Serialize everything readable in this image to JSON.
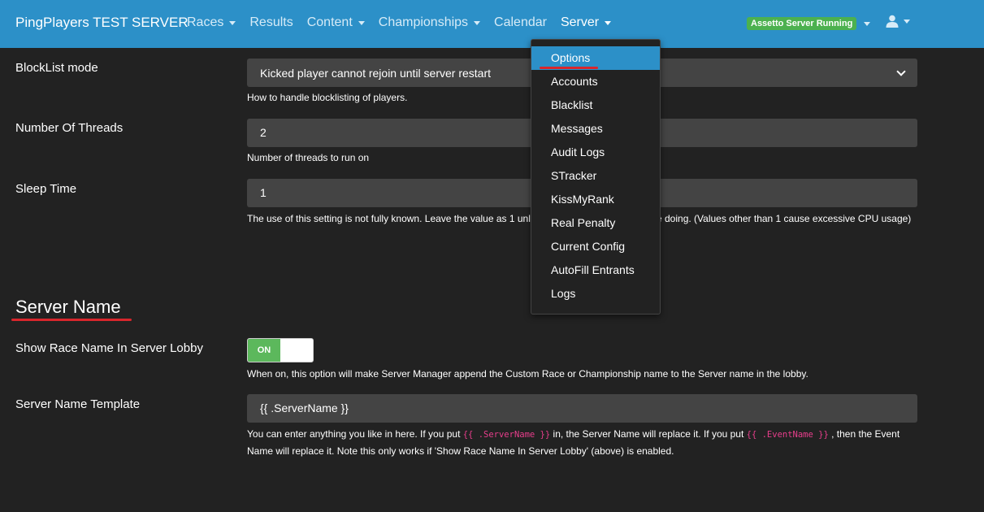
{
  "navbar": {
    "brand": "PingPlayers TEST SERVER",
    "links": [
      {
        "label": "Races",
        "dropdown": true
      },
      {
        "label": "Results",
        "dropdown": false
      },
      {
        "label": "Content",
        "dropdown": true
      },
      {
        "label": "Championships",
        "dropdown": true
      },
      {
        "label": "Calendar",
        "dropdown": false
      },
      {
        "label": "Server",
        "dropdown": true,
        "active": true
      }
    ],
    "status_badge": "Assetto Server Running",
    "user_icon": "user-icon",
    "colors": {
      "navbar_bg": "#2c90c8",
      "badge_bg": "#4cb14f"
    }
  },
  "server_menu": {
    "items": [
      {
        "label": "Options",
        "active": true
      },
      {
        "label": "Accounts"
      },
      {
        "label": "Blacklist"
      },
      {
        "label": "Messages"
      },
      {
        "label": "Audit Logs"
      },
      {
        "label": "STracker"
      },
      {
        "label": "KissMyRank"
      },
      {
        "label": "Real Penalty"
      },
      {
        "label": "Current Config"
      },
      {
        "label": "AutoFill Entrants"
      },
      {
        "label": "Logs"
      }
    ]
  },
  "form": {
    "blocklist_mode": {
      "label": "BlockList mode",
      "value": "Kicked player cannot rejoin until server restart",
      "help": "How to handle blocklisting of players."
    },
    "threads": {
      "label": "Number Of Threads",
      "value": "2",
      "help": "Number of threads to run on"
    },
    "sleep_time": {
      "label": "Sleep Time",
      "value": "1",
      "help_left": "The use of this setting is not fully known. Leave the value as 1 unle",
      "help_right": "e doing. (Values other than 1 cause excessive CPU usage)"
    }
  },
  "server_name_section": {
    "title": "Server Name",
    "show_race_name": {
      "label": "Show Race Name In Server Lobby",
      "toggle_label": "ON",
      "enabled": true,
      "help": "When on, this option will make Server Manager append the Custom Race or Championship name to the Server name in the lobby."
    },
    "template": {
      "label": "Server Name Template",
      "value": "{{ .ServerName }}",
      "help_1": "You can enter anything you like in here. If you put ",
      "code_1": "{{ .ServerName }}",
      "help_2": " in, the Server Name will replace it. If you put ",
      "code_2": "{{ .EventName }}",
      "help_3": " , then the Event Name will replace it. Note this only works if 'Show Race Name In Server Lobby' (above) is enabled."
    }
  },
  "colors": {
    "page_bg": "#222222",
    "field_bg": "#444444",
    "accent_red": "#d9262c",
    "code_pink": "#e83e8c",
    "toggle_on": "#5cb85c"
  }
}
